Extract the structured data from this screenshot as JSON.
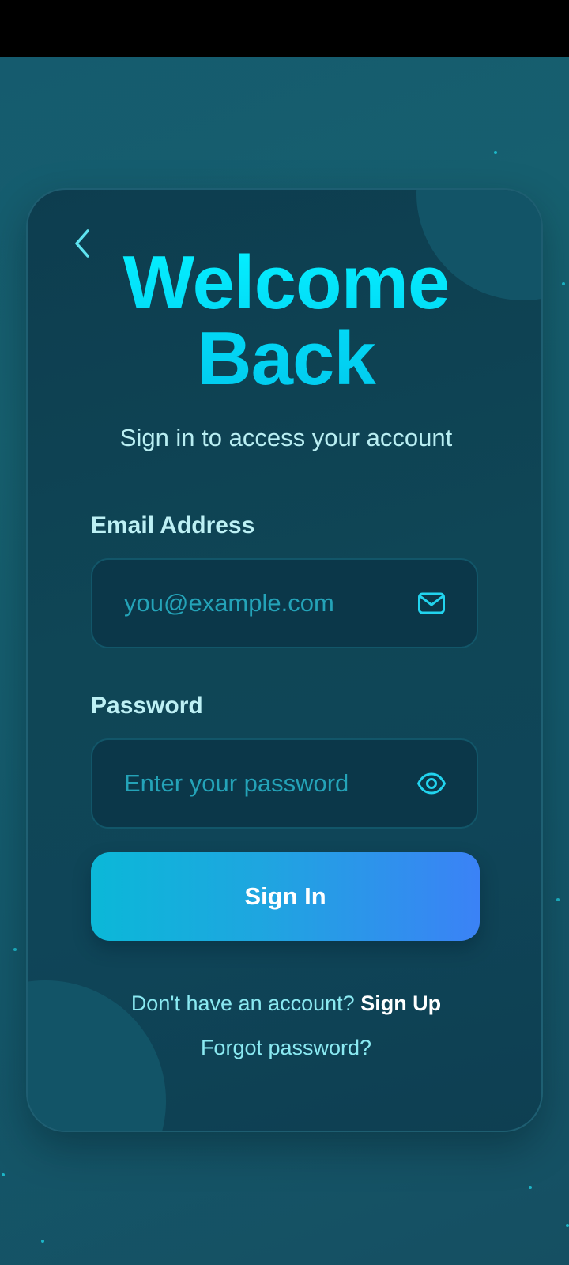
{
  "colors": {
    "accent_cyan": "#05f0ff",
    "button_gradient_start": "#0bb8d8",
    "button_gradient_end": "#3b82f6",
    "background": "#155a6e",
    "card": "#0f4656"
  },
  "header": {
    "back_icon": "chevron-left-icon",
    "title_line1": "Welcome",
    "title_line2": "Back",
    "subtitle": "Sign in to access your account"
  },
  "form": {
    "email": {
      "label": "Email Address",
      "placeholder": "you@example.com",
      "value": "",
      "icon": "mail-icon"
    },
    "password": {
      "label": "Password",
      "placeholder": "Enter your password",
      "value": "",
      "icon": "eye-icon"
    },
    "submit_label": "Sign In"
  },
  "footer": {
    "signup_prompt": "Don't have an account?",
    "signup_link": "Sign Up",
    "forgot_link": "Forgot password?"
  }
}
